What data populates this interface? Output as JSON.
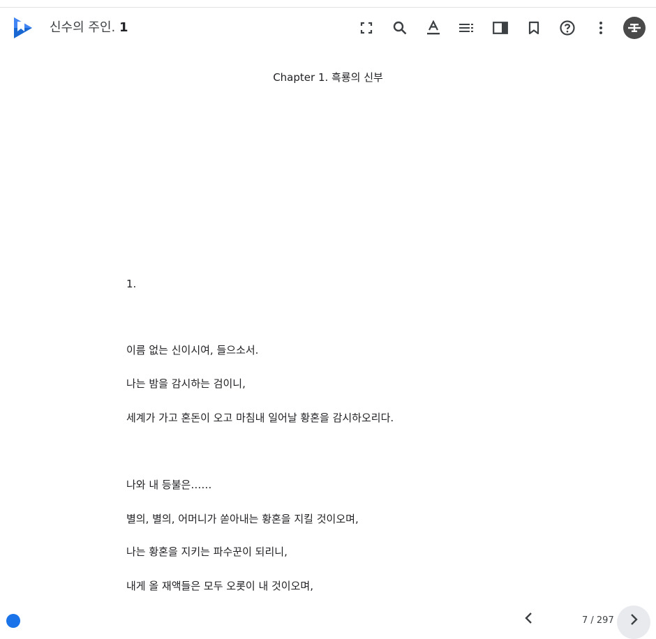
{
  "header": {
    "title_main": "신수의 주인.",
    "title_volume": "1",
    "toolbar": {
      "fullscreen_icon": "fullscreen-icon",
      "search_icon": "search-icon",
      "text_format_icon": "text-format-icon",
      "contents_icon": "contents-icon",
      "side_panel_icon": "side-panel-icon",
      "bookmark_icon": "bookmark-icon",
      "help_icon": "help-icon",
      "more_icon": "more-vert-icon"
    },
    "accent_color": "#1a73e8"
  },
  "reader": {
    "chapter_title": "Chapter 1. 흑룡의 신부",
    "paragraphs": [
      "1.",
      "이름 없는 신이시여, 들으소서.",
      "나는 밤을 감시하는 검이니,",
      "세계가 가고 혼돈이 오고 마침내 일어날 황혼을 감시하오리다.",
      "나와 내 등불은……",
      "별의, 별의, 어머니가 쏟아내는 황혼을 지킬 것이오며,",
      "나는 황혼을 지키는 파수꾼이 되리니,",
      "내게 올 재액들은 모두 오롯이 내 것이오며,"
    ]
  },
  "footer": {
    "page_indicator": "7 / 297"
  }
}
